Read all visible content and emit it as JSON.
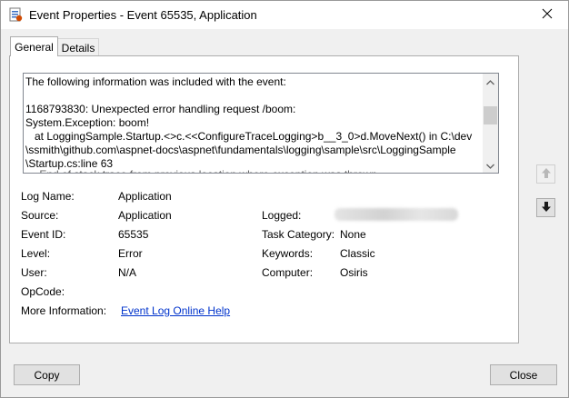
{
  "window": {
    "title": "Event Properties - Event 65535, Application"
  },
  "tabs": [
    {
      "label": "General"
    },
    {
      "label": "Details"
    }
  ],
  "description": {
    "lines": [
      "The following information was included with the event:",
      "",
      "1168793830: Unexpected error handling request /boom:",
      "System.Exception: boom!",
      "   at LoggingSample.Startup.<>c.<<ConfigureTraceLogging>b__3_0>d.MoveNext() in C:\\dev",
      "\\ssmith\\github.com\\aspnet-docs\\aspnet\\fundamentals\\logging\\sample\\src\\LoggingSample",
      "\\Startup.cs:line 63"
    ],
    "partial_line": "--- End of stack trace from previous location where exception was thrown ---"
  },
  "fields": {
    "log_name": {
      "label": "Log Name:",
      "value": "Application"
    },
    "source": {
      "label": "Source:",
      "value": "Application"
    },
    "logged": {
      "label": "Logged:",
      "value": ""
    },
    "event_id": {
      "label": "Event ID:",
      "value": "65535"
    },
    "task_category": {
      "label": "Task Category:",
      "value": "None"
    },
    "level": {
      "label": "Level:",
      "value": "Error"
    },
    "keywords": {
      "label": "Keywords:",
      "value": "Classic"
    },
    "user": {
      "label": "User:",
      "value": "N/A"
    },
    "computer": {
      "label": "Computer:",
      "value": "Osiris"
    },
    "opcode": {
      "label": "OpCode:",
      "value": ""
    },
    "more_info": {
      "label": "More Information:",
      "link": "Event Log Online Help"
    }
  },
  "nav": {
    "up_icon": "arrow-up-icon",
    "down_icon": "arrow-down-icon"
  },
  "buttons": {
    "copy": "Copy",
    "close": "Close"
  },
  "colors": {
    "link": "#0033cc",
    "background": "#f0f0f0",
    "panel": "#ffffff"
  }
}
